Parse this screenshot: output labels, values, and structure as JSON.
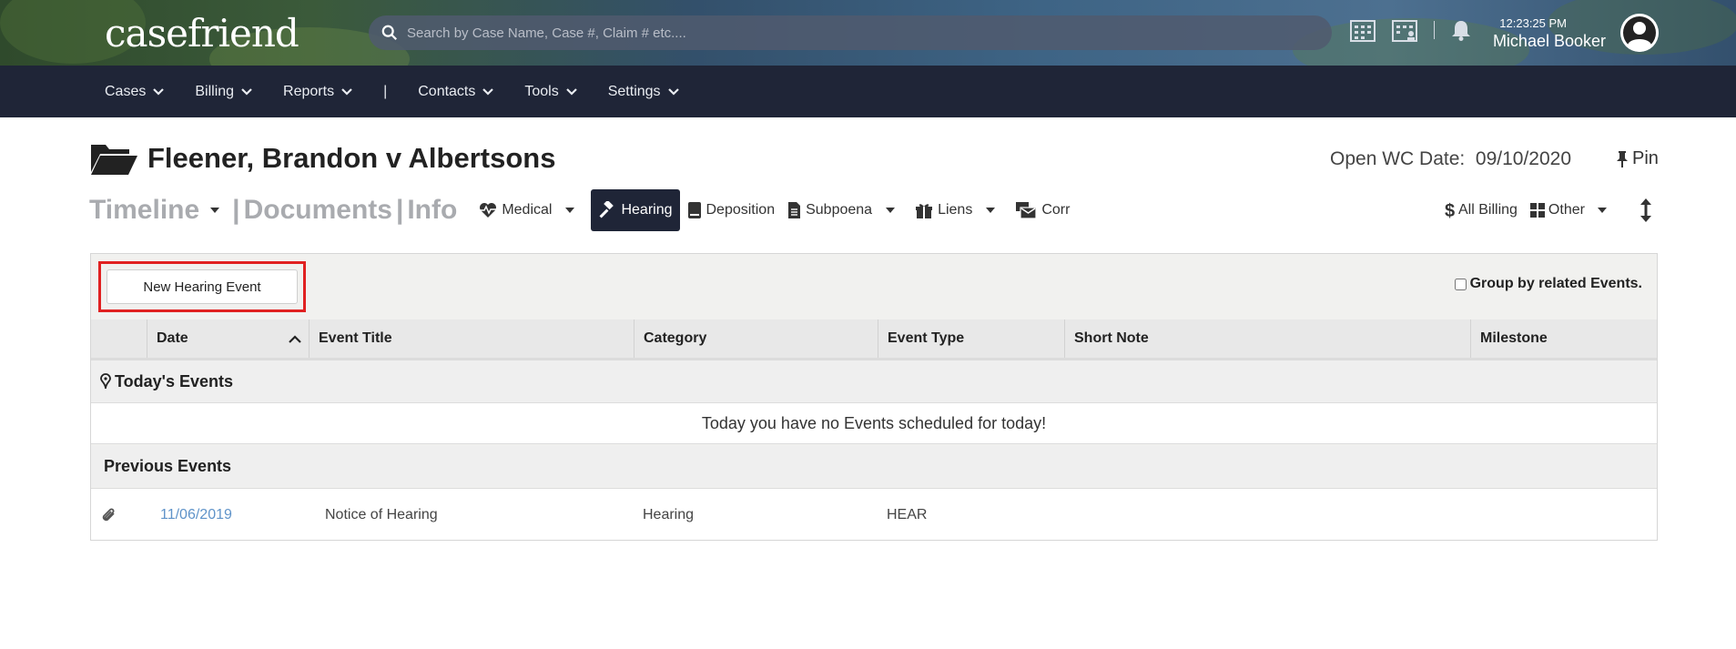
{
  "header": {
    "logo": "casefriend",
    "search_placeholder": "Search by Case Name, Case #, Claim # etc....",
    "time": "12:23:25 PM",
    "user_name": "Michael Booker"
  },
  "nav": {
    "items": [
      "Cases",
      "Billing",
      "Reports",
      "|",
      "Contacts",
      "Tools",
      "Settings"
    ]
  },
  "case": {
    "title": "Fleener, Brandon v Albertsons",
    "open_date_label": "Open WC Date:",
    "open_date": "09/10/2020",
    "pin_label": "Pin"
  },
  "tabs": {
    "timeline": "Timeline",
    "documents": "Documents",
    "info": "Info",
    "sep": "|",
    "medical": "Medical",
    "hearing": "Hearing",
    "deposition": "Deposition",
    "subpoena": "Subpoena",
    "liens": "Liens",
    "corr": "Corr",
    "all_billing": "All Billing",
    "other": "Other"
  },
  "panel": {
    "new_button": "New Hearing Event",
    "group_by": "Group by related Events.",
    "columns": [
      "Date",
      "Event Title",
      "Category",
      "Event Type",
      "Short Note",
      "Milestone"
    ],
    "todays_events_label": "Today's Events",
    "no_events_message": "Today you have no Events scheduled for today!",
    "previous_events_label": "Previous Events",
    "rows": [
      {
        "date": "11/06/2019",
        "event_title": "Notice of Hearing",
        "category": "Hearing",
        "event_type": "HEAR",
        "short_note": "",
        "milestone": ""
      }
    ]
  },
  "colors": {
    "nav_bg": "#1f2537",
    "active_tab_bg": "#1f2537",
    "highlight_border": "#e02121",
    "link": "#5f93c9"
  }
}
